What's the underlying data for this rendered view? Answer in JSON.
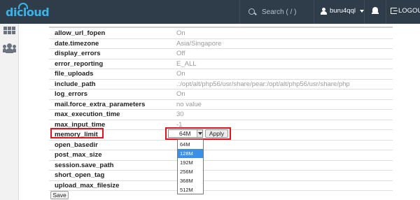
{
  "header": {
    "logo_text": "dicloud",
    "search_placeholder": "Search ( / )",
    "username": "buru4qql",
    "logout_label": "LOGOUT"
  },
  "settings": {
    "rows": [
      {
        "name": "allow_url_fopen",
        "value": "On"
      },
      {
        "name": "date.timezone",
        "value": "Asia/Singapore"
      },
      {
        "name": "display_errors",
        "value": "Off"
      },
      {
        "name": "error_reporting",
        "value": "E_ALL"
      },
      {
        "name": "file_uploads",
        "value": "On"
      },
      {
        "name": "include_path",
        "value": ".:/opt/alt/php56/usr/share/pear:/opt/alt/php56/usr/share/php"
      },
      {
        "name": "log_errors",
        "value": "On"
      },
      {
        "name": "mail.force_extra_parameters",
        "value": "no value"
      },
      {
        "name": "max_execution_time",
        "value": "30"
      },
      {
        "name": "max_input_time",
        "value": "-1"
      },
      {
        "name": "memory_limit",
        "value": ""
      },
      {
        "name": "open_basedir",
        "value": ""
      },
      {
        "name": "post_max_size",
        "value": ""
      },
      {
        "name": "session.save_path",
        "value": ""
      },
      {
        "name": "short_open_tag",
        "value": ""
      },
      {
        "name": "upload_max_filesize",
        "value": ""
      }
    ]
  },
  "memory_limit_control": {
    "selected": "64M",
    "apply_label": "Apply",
    "options": [
      "64M",
      "128M",
      "192M",
      "256M",
      "368M",
      "512M"
    ],
    "highlighted_option": "128M"
  },
  "save_label": "Save",
  "colors": {
    "topbar": "#2f3c4a",
    "brand": "#39b4e8",
    "highlight_box": "#e0141e",
    "option_selected": "#3c8fe6"
  }
}
